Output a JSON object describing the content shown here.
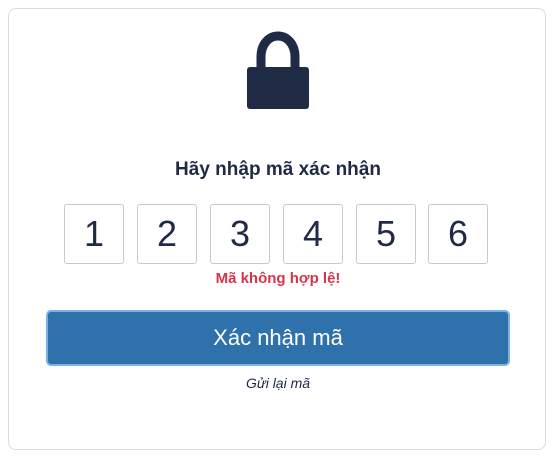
{
  "header": {
    "icon": "lock-icon",
    "title": "Hãy nhập mã xác nhận"
  },
  "code": {
    "digits": [
      "1",
      "2",
      "3",
      "4",
      "5",
      "6"
    ]
  },
  "error": {
    "message": "Mã không hợp lệ!"
  },
  "actions": {
    "submit_label": "Xác nhận mã",
    "resend_label": "Gửi lại mã"
  },
  "colors": {
    "primary": "#2f72ab",
    "primary_border": "#7ab2e8",
    "error": "#d9334a",
    "text": "#1f2a44"
  }
}
